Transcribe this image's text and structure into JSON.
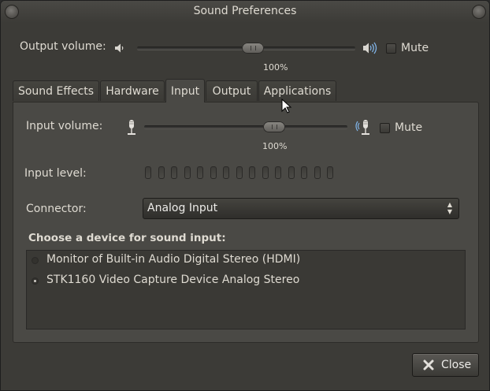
{
  "window": {
    "title": "Sound Preferences"
  },
  "output_volume": {
    "label": "Output volume:",
    "percent_text": "100%",
    "level": 1.0,
    "mute_label": "Mute",
    "muted": false
  },
  "tabs": [
    {
      "label": "Sound Effects",
      "active": false
    },
    {
      "label": "Hardware",
      "active": false
    },
    {
      "label": "Input",
      "active": true
    },
    {
      "label": "Output",
      "active": false
    },
    {
      "label": "Applications",
      "active": false
    }
  ],
  "input": {
    "volume_label": "Input volume:",
    "percent_text": "100%",
    "level": 1.0,
    "mute_label": "Mute",
    "muted": false,
    "level_label": "Input level:",
    "level_bar_count": 15,
    "connector_label": "Connector:",
    "connector_value": "Analog Input",
    "device_heading": "Choose a device for sound input:",
    "devices": [
      {
        "name": "Monitor of Built-in Audio Digital Stereo (HDMI)",
        "selected": false
      },
      {
        "name": "STK1160 Video Capture Device Analog Stereo",
        "selected": true
      }
    ]
  },
  "buttons": {
    "close_label": "Close"
  },
  "icons": {
    "speaker_low": "speaker-low-icon",
    "speaker_high": "speaker-high-icon",
    "mic_low": "microphone-low-icon",
    "mic_high": "microphone-high-icon",
    "close": "close-x-icon"
  }
}
